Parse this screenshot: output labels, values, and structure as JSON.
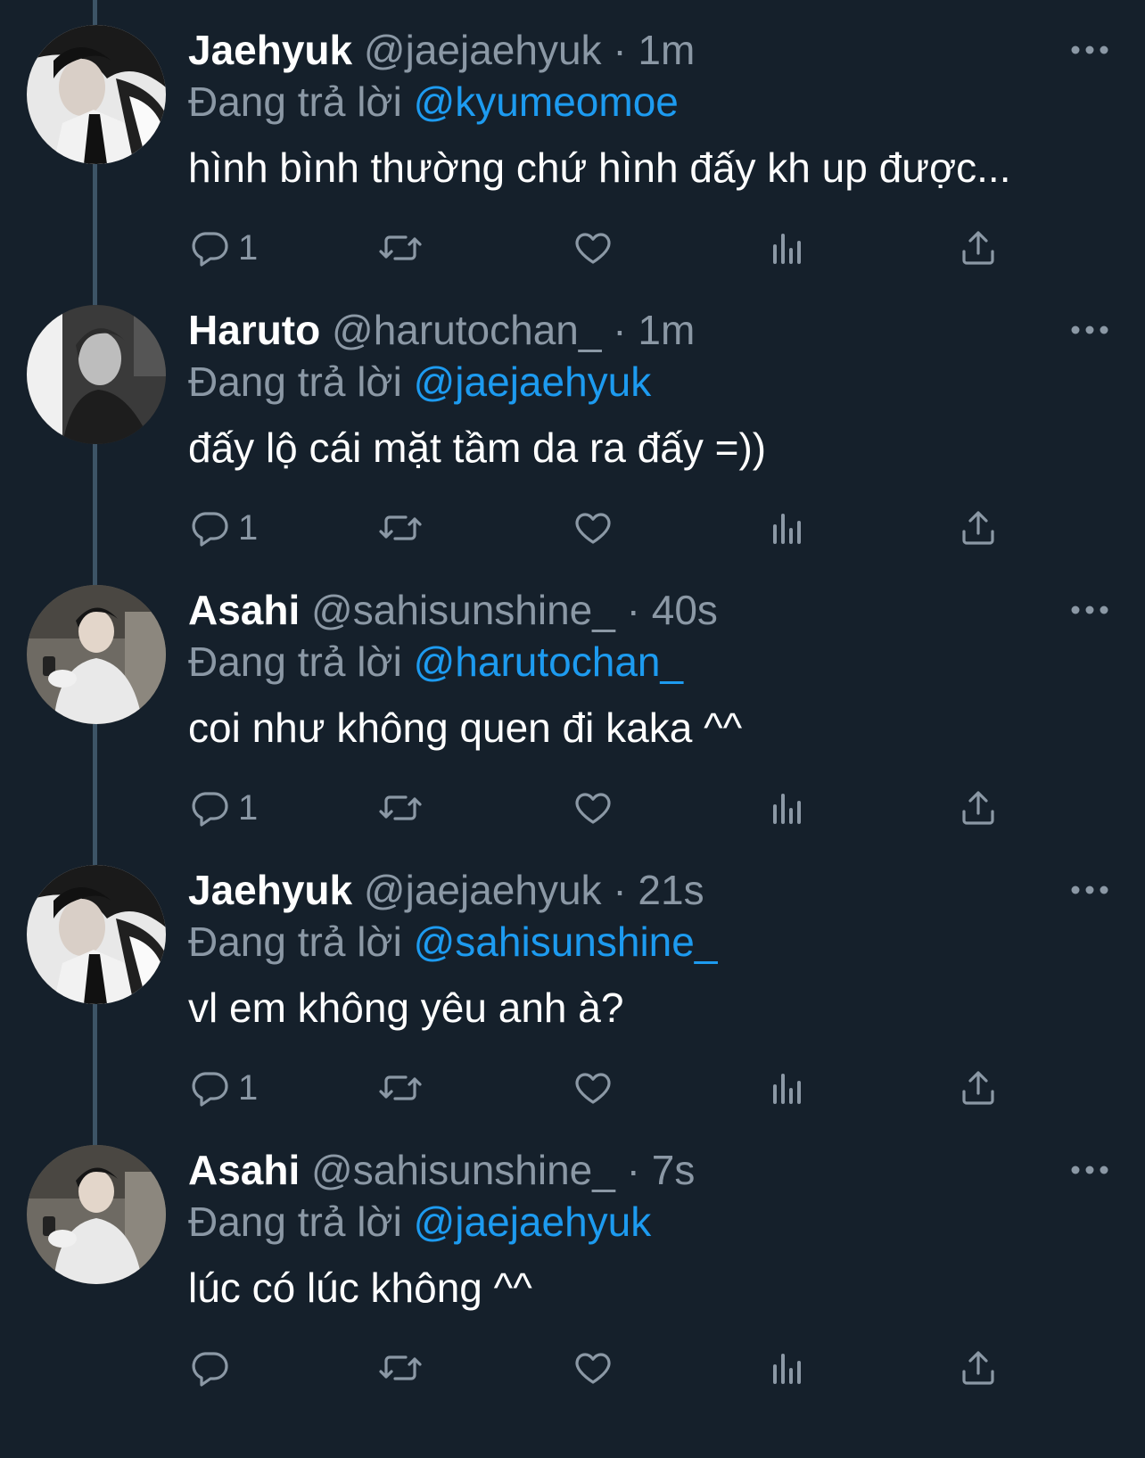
{
  "tweets": [
    {
      "display_name": "Jaehyuk",
      "handle": "@jaejaehyuk",
      "time": "· 1m",
      "reply_prefix": "Đang trả lời",
      "reply_to": "@kyumeomoe",
      "text": "hình bình thường chứ hình đấy kh up được...",
      "reply_count": "1",
      "avatar": "jaehyuk"
    },
    {
      "display_name": "Haruto",
      "handle": "@harutochan_",
      "time": "· 1m",
      "reply_prefix": "Đang trả lời",
      "reply_to": "@jaejaehyuk",
      "text": "đấy lộ cái mặt tầm da ra đấy =))",
      "reply_count": "1",
      "avatar": "haruto"
    },
    {
      "display_name": "Asahi",
      "handle": "@sahisunshine_",
      "time": "· 40s",
      "reply_prefix": "Đang trả lời",
      "reply_to": "@harutochan_",
      "text": "coi như không quen đi kaka ^^",
      "reply_count": "1",
      "avatar": "asahi"
    },
    {
      "display_name": "Jaehyuk",
      "handle": "@jaejaehyuk",
      "time": "· 21s",
      "reply_prefix": "Đang trả lời",
      "reply_to": "@sahisunshine_",
      "text": "vl em không yêu anh à?",
      "reply_count": "1",
      "avatar": "jaehyuk"
    },
    {
      "display_name": "Asahi",
      "handle": "@sahisunshine_",
      "time": "· 7s",
      "reply_prefix": "Đang trả lời",
      "reply_to": "@jaejaehyuk",
      "text": "lúc có lúc không ^^",
      "reply_count": "",
      "avatar": "asahi"
    }
  ],
  "icons": {
    "reply": "reply-icon",
    "retweet": "retweet-icon",
    "like": "heart-icon",
    "views": "views-icon",
    "share": "share-icon",
    "more": "more-icon"
  },
  "colors": {
    "background": "#15202b",
    "name": "#ffffff",
    "muted": "#8b98a5",
    "mention": "#1d9bf0",
    "thread_line": "#3d5466"
  }
}
